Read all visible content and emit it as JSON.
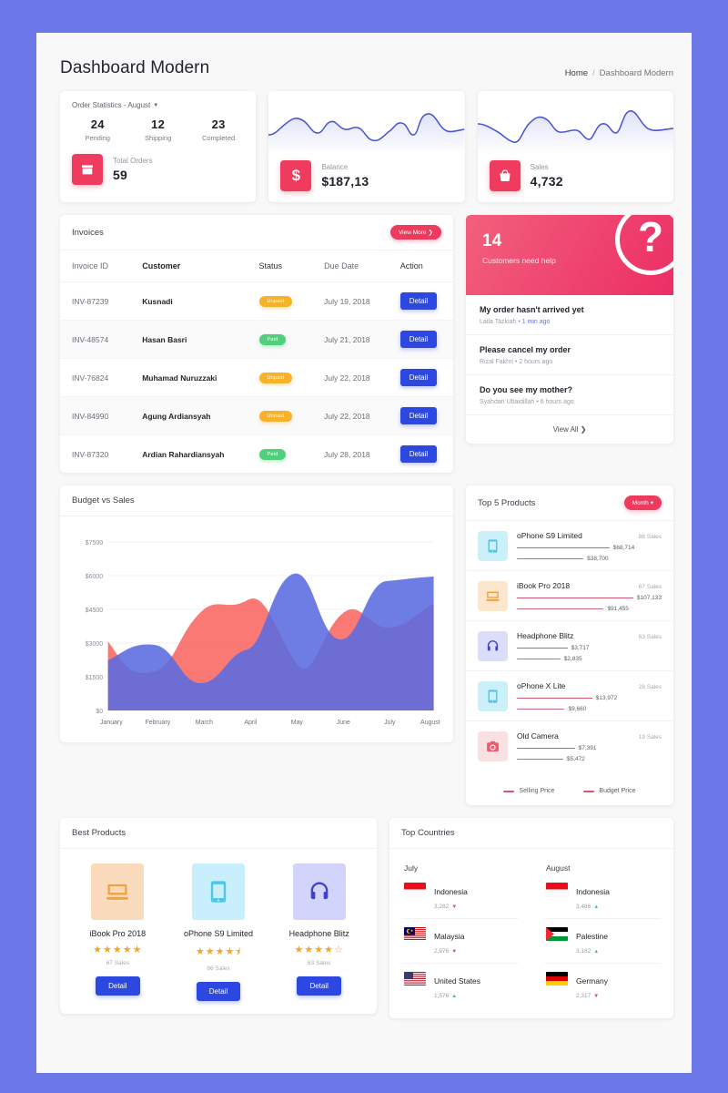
{
  "header": {
    "title": "Dashboard Modern",
    "breadcrumb_home": "Home",
    "breadcrumb_sep": "/",
    "breadcrumb_current": "Dashboard Modern"
  },
  "order_statistics": {
    "heading": "Order Statistics - August",
    "stats": [
      {
        "value": "24",
        "label": "Pending"
      },
      {
        "value": "12",
        "label": "Shipping"
      },
      {
        "value": "23",
        "label": "Completed"
      }
    ],
    "total_label": "Total Orders",
    "total_value": "59",
    "icon": "box-icon"
  },
  "balance_card": {
    "label": "Balance",
    "value": "$187,13",
    "icon": "dollar-icon"
  },
  "sales_card": {
    "label": "Sales",
    "value": "4,732",
    "icon": "bag-icon"
  },
  "invoices": {
    "title": "Invoices",
    "view_more": "View More",
    "columns": [
      "Invoice ID",
      "Customer",
      "Status",
      "Due Date",
      "Action"
    ],
    "rows": [
      {
        "id": "INV-87239",
        "customer": "Kusnadi",
        "status": "Unpaid",
        "status_kind": "unpaid",
        "due": "July 19, 2018",
        "action": "Detail"
      },
      {
        "id": "INV-48574",
        "customer": "Hasan Basri",
        "status": "Paid",
        "status_kind": "paid",
        "due": "July 21, 2018",
        "action": "Detail"
      },
      {
        "id": "INV-76824",
        "customer": "Muhamad Nuruzzaki",
        "status": "Unpaid",
        "status_kind": "unpaid",
        "due": "July 22, 2018",
        "action": "Detail"
      },
      {
        "id": "INV-84990",
        "customer": "Agung Ardiansyah",
        "status": "Unpaid",
        "status_kind": "unpaid",
        "due": "July 22, 2018",
        "action": "Detail"
      },
      {
        "id": "INV-87320",
        "customer": "Ardian Rahardiansyah",
        "status": "Paid",
        "status_kind": "paid",
        "due": "July 28, 2018",
        "action": "Detail"
      }
    ]
  },
  "help": {
    "count": "14",
    "subtitle": "Customers need help",
    "icon": "question-mark-icon",
    "items": [
      {
        "question": "My order hasn't arrived yet",
        "author": "Laila Tazkiah",
        "dot": "•",
        "time": "1 min ago",
        "recent": true
      },
      {
        "question": "Please cancel my order",
        "author": "Rizal Fakhri",
        "dot": "•",
        "time": "2 hours ago",
        "recent": false
      },
      {
        "question": "Do you see my mother?",
        "author": "Syahdan Ubaidillah",
        "dot": "•",
        "time": "6 hours ago",
        "recent": false
      }
    ],
    "view_all": "View All"
  },
  "budget_vs_sales": {
    "title": "Budget vs Sales"
  },
  "chart_data": {
    "type": "area",
    "title": "Budget vs Sales",
    "categories": [
      "January",
      "February",
      "March",
      "April",
      "May",
      "June",
      "July",
      "August"
    ],
    "series": [
      {
        "name": "Budget",
        "color": "#fa6e68",
        "values": [
          3080,
          1750,
          4300,
          4950,
          2300,
          4250,
          4000,
          4750
        ]
      },
      {
        "name": "Sales",
        "color": "#5a6be0",
        "values": [
          2250,
          3250,
          2100,
          2950,
          6250,
          5100,
          5850,
          6100
        ]
      }
    ],
    "xlabel": "",
    "ylabel": "",
    "ylim": [
      0,
      7500
    ],
    "yticks": [
      "$0",
      "$1500",
      "$3000",
      "$4500",
      "$6000",
      "$7500"
    ],
    "grid": true,
    "legend": "none"
  },
  "top_products": {
    "title": "Top 5 Products",
    "filter": "Month",
    "items": [
      {
        "name": "oPhone S9 Limited",
        "sales": "86 Sales",
        "icon": "phone-icon",
        "icon_bg": "#ccf0fa",
        "icon_color": "#4cc7e8",
        "selling": "$68,714",
        "budget": "$38,700",
        "selling_pct": 64,
        "budget_pct": 46
      },
      {
        "name": "iBook Pro 2018",
        "sales": "67 Sales",
        "icon": "laptop-icon",
        "icon_bg": "#fde6cc",
        "icon_color": "#f2a13c",
        "selling": "$107,133",
        "budget": "$91,455",
        "selling_pct": 82,
        "budget_pct": 60
      },
      {
        "name": "Headphone Blitz",
        "sales": "63 Sales",
        "icon": "headphone-icon",
        "icon_bg": "#dcdcfb",
        "icon_color": "#4043c9",
        "selling": "$3,717",
        "budget": "$2,835",
        "selling_pct": 35,
        "budget_pct": 30
      },
      {
        "name": "oPhone X Lite",
        "sales": "28 Sales",
        "icon": "phone-icon",
        "icon_bg": "#ccf0fa",
        "icon_color": "#4cc7e8",
        "selling": "$13,972",
        "budget": "$9,660",
        "selling_pct": 52,
        "budget_pct": 33
      },
      {
        "name": "Old Camera",
        "sales": "19 Sales",
        "icon": "camera-icon",
        "icon_bg": "#fbe0e2",
        "icon_color": "#ef5a6d",
        "selling": "$7,391",
        "budget": "$5,472",
        "selling_pct": 40,
        "budget_pct": 32
      }
    ],
    "legend": [
      {
        "label": "Selling Price",
        "color": "#d4566f"
      },
      {
        "label": "Budget Price",
        "color": "#d4566f"
      }
    ]
  },
  "best_products": {
    "title": "Best Products",
    "items": [
      {
        "name": "iBook Pro 2018",
        "icon": "laptop-icon",
        "icon_bg": "#fadcbd",
        "icon_color": "#f2a13c",
        "rating": 5,
        "stars": "★★★★★",
        "sales": "67 Sales",
        "button": "Detail"
      },
      {
        "name": "oPhone S9 Limited",
        "icon": "phone-icon",
        "icon_bg": "#c9eefc",
        "icon_color": "#4cc7e8",
        "rating": 4.5,
        "stars": "★★★★⯨",
        "sales": "86 Sales",
        "button": "Detail"
      },
      {
        "name": "Headphone Blitz",
        "icon": "headphone-icon",
        "icon_bg": "#d3d4fb",
        "icon_color": "#4043c9",
        "rating": 4,
        "stars": "★★★★☆",
        "sales": "63 Sales",
        "button": "Detail"
      }
    ]
  },
  "top_countries": {
    "title": "Top Countries",
    "columns": [
      {
        "month": "July",
        "rows": [
          {
            "country": "Indonesia",
            "flag": "flag-indonesia",
            "value": "3,282",
            "trend": "down"
          },
          {
            "country": "Malaysia",
            "flag": "flag-malaysia",
            "value": "2,976",
            "trend": "down"
          },
          {
            "country": "United States",
            "flag": "flag-united-states",
            "value": "1,576",
            "trend": "up"
          }
        ]
      },
      {
        "month": "August",
        "rows": [
          {
            "country": "Indonesia",
            "flag": "flag-indonesia",
            "value": "3,486",
            "trend": "up"
          },
          {
            "country": "Palestine",
            "flag": "flag-palestine",
            "value": "3,182",
            "trend": "up"
          },
          {
            "country": "Germany",
            "flag": "flag-germany",
            "value": "2,317",
            "trend": "down"
          }
        ]
      }
    ]
  },
  "colors": {
    "app_bg": "#6c77e8",
    "page_bg": "#f8f8f9",
    "accent_red": "#ef3c5e",
    "accent_blue": "#2d48e0",
    "chart_blue": "#5a6be0",
    "chart_red": "#fa6e68",
    "badge_unpaid": "#f7b22a",
    "badge_paid": "#4fd17b"
  }
}
